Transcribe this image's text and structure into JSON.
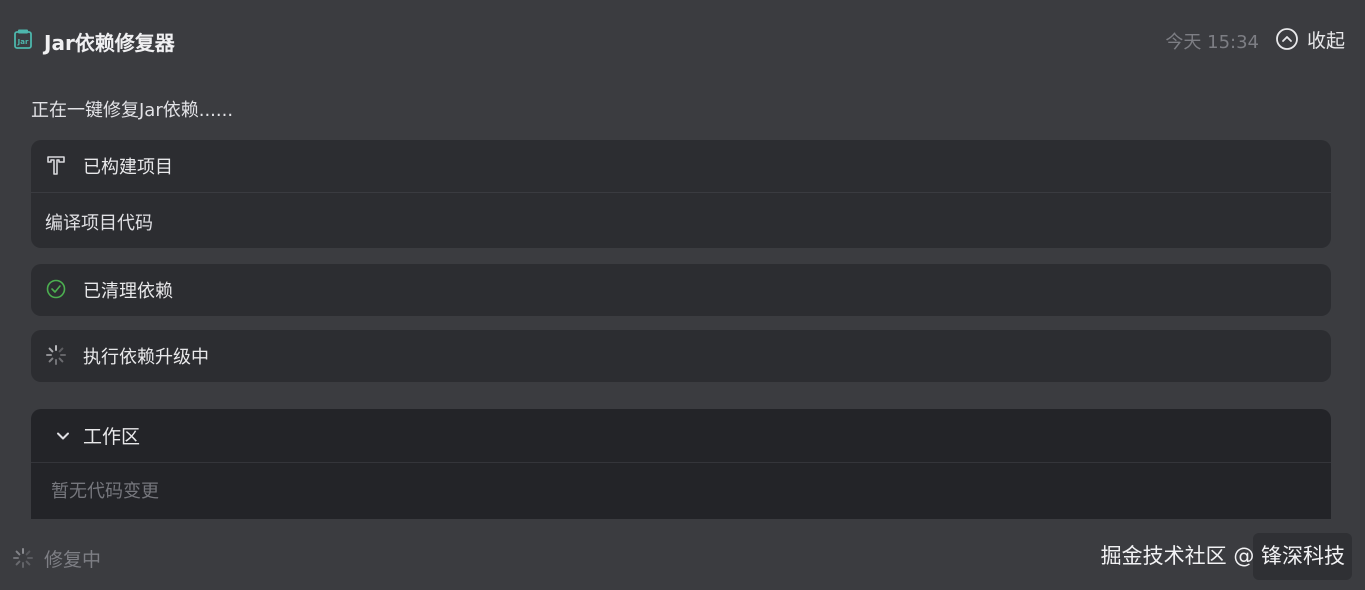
{
  "header": {
    "app_icon": "jar-icon",
    "title": "Jar依赖修复器",
    "timestamp": "今天 15:34",
    "collapse_icon": "chevron-up-circle-icon",
    "collapse_label": "收起"
  },
  "intro_text": "正在一键修复Jar依赖......",
  "steps": [
    {
      "icon": "hammer-icon",
      "label": "已构建项目",
      "detail": "编译项目代码"
    },
    {
      "icon": "check-circle-icon",
      "icon_color": "#4caf50",
      "label": "已清理依赖"
    },
    {
      "icon": "spinner-icon",
      "label": "执行依赖升级中"
    }
  ],
  "workspace": {
    "chevron_icon": "chevron-down-icon",
    "title": "工作区",
    "empty_text": "暂无代码变更"
  },
  "footer": {
    "status_icon": "spinner-icon",
    "status_label": "修复中"
  },
  "watermark": "掘金技术社区 @ 锋深科技",
  "colors": {
    "background": "#3b3c40",
    "card": "#2c2d31",
    "workspace": "#232428",
    "success": "#4caf50",
    "muted_text": "#7d7e84"
  }
}
